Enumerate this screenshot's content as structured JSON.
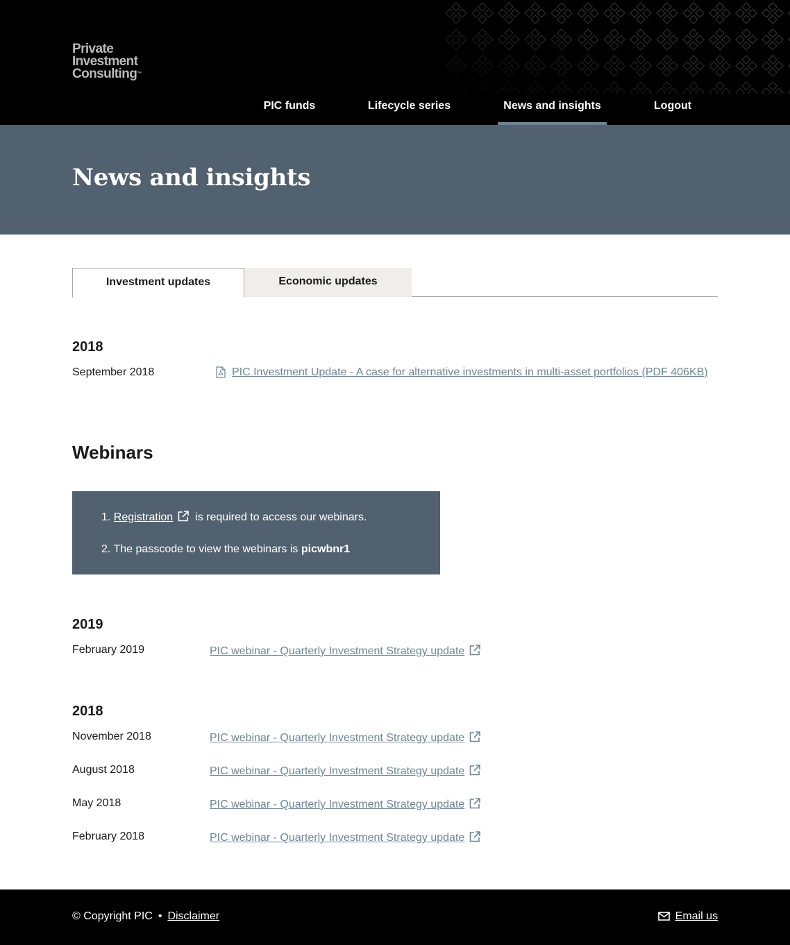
{
  "header": {
    "logo_lines": [
      "Private",
      "Investment",
      "Consulting"
    ],
    "logo_tm": "™",
    "nav": [
      {
        "label": "PIC funds",
        "active": false
      },
      {
        "label": "Lifecycle series",
        "active": false
      },
      {
        "label": "News and insights",
        "active": true
      },
      {
        "label": "Logout",
        "active": false
      }
    ]
  },
  "banner": {
    "title": "News and insights"
  },
  "tabs": [
    {
      "label": "Investment updates",
      "active": true
    },
    {
      "label": "Economic updates",
      "active": false
    }
  ],
  "investment_updates": {
    "year": "2018",
    "items": [
      {
        "date": "September 2018",
        "link": "PIC Investment Update - A case for alternative investments in multi-asset portfolios (PDF 406KB)",
        "icon": "pdf-icon"
      }
    ]
  },
  "webinars": {
    "title": "Webinars",
    "notes": {
      "n1": "1.",
      "registration_link": "Registration",
      "n1_text": "is required to access our webinars.",
      "n2": "2.",
      "n2_text": "The passcode to view the webinars is",
      "passcode": "picwbnr1"
    },
    "groups": [
      {
        "year": "2019",
        "items": [
          {
            "date": "February 2019",
            "link": "PIC webinar - Quarterly Investment Strategy update"
          }
        ]
      },
      {
        "year": "2018",
        "items": [
          {
            "date": "November 2018",
            "link": "PIC webinar - Quarterly Investment Strategy update"
          },
          {
            "date": "August 2018",
            "link": "PIC webinar - Quarterly Investment Strategy update"
          },
          {
            "date": "May 2018",
            "link": "PIC webinar - Quarterly Investment Strategy update"
          },
          {
            "date": "February 2018",
            "link": "PIC webinar - Quarterly Investment Strategy update"
          }
        ]
      }
    ]
  },
  "footer": {
    "copyright": "© Copyright PIC",
    "separator": "•",
    "disclaimer": "Disclaimer",
    "email": "Email us"
  },
  "colors": {
    "header_bg": "#000000",
    "banner_bg": "#526170",
    "link": "#6d8595",
    "nav_active_underline": "#6b8494",
    "tab_inactive_bg": "#efeeec"
  }
}
